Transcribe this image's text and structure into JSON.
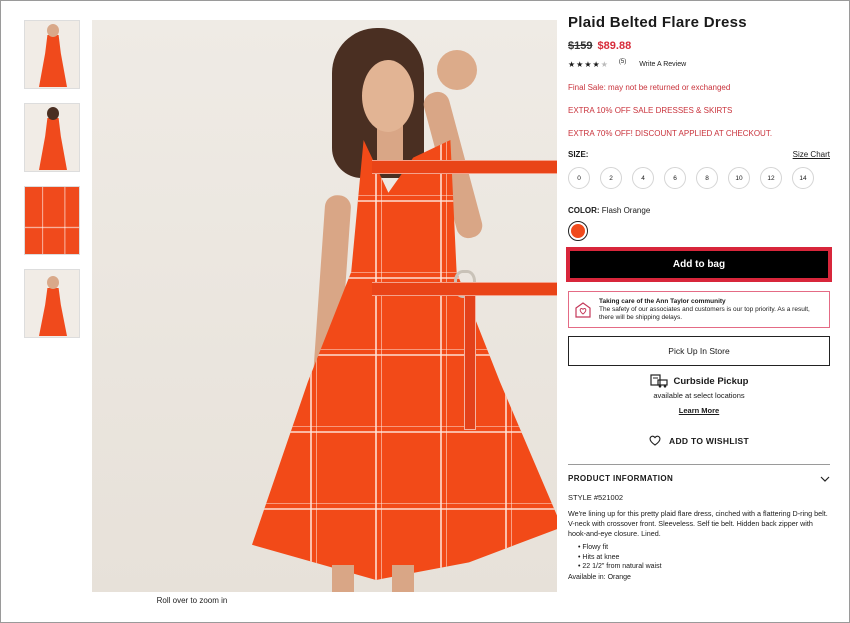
{
  "product": {
    "title": "Plaid Belted Flare Dress",
    "price_original": "$159",
    "price_sale": "$89.88",
    "rating_count": "(5)",
    "write_review": "Write A Review",
    "promos": [
      "Final Sale: may not be returned or exchanged",
      "EXTRA 10% OFF SALE DRESSES & SKIRTS",
      "EXTRA 70% OFF! DISCOUNT APPLIED AT CHECKOUT."
    ],
    "size_label": "SIZE:",
    "size_chart": "Size Chart",
    "sizes": [
      "0",
      "2",
      "4",
      "6",
      "8",
      "10",
      "12",
      "14"
    ],
    "color_label": "COLOR:",
    "color_value": "Flash Orange",
    "color_hex": "#f04a1c"
  },
  "rating": {
    "value": 4,
    "max": 5
  },
  "actions": {
    "add_to_bag": "Add to bag",
    "pick_up": "Pick Up In Store",
    "wishlist": "ADD TO WISHLIST"
  },
  "community": {
    "title": "Taking care of the Ann Taylor community",
    "body": "The safety of our associates and customers is our top priority. As a result, there will be shipping delays."
  },
  "curbside": {
    "title": "Curbside Pickup",
    "subtitle": "available at select locations",
    "learn_more": "Learn More"
  },
  "info": {
    "heading": "PRODUCT INFORMATION",
    "style": "STYLE #521002",
    "description": "We're lining up for this pretty plaid flare dress, cinched with a flattering D-ring belt. V-neck with crossover front. Sleeveless. Self tie belt. Hidden back zipper with hook-and-eye closure. Lined.",
    "bullets": [
      "Flowy fit",
      "Hits at knee",
      "22 1/2\" from natural waist"
    ],
    "available": "Available in: Orange"
  },
  "gallery": {
    "zoom_note": "Roll over to zoom in"
  },
  "colors": {
    "accent_red": "#d72c3a",
    "button_border": "#d8263b",
    "community_border": "#e46b85"
  }
}
